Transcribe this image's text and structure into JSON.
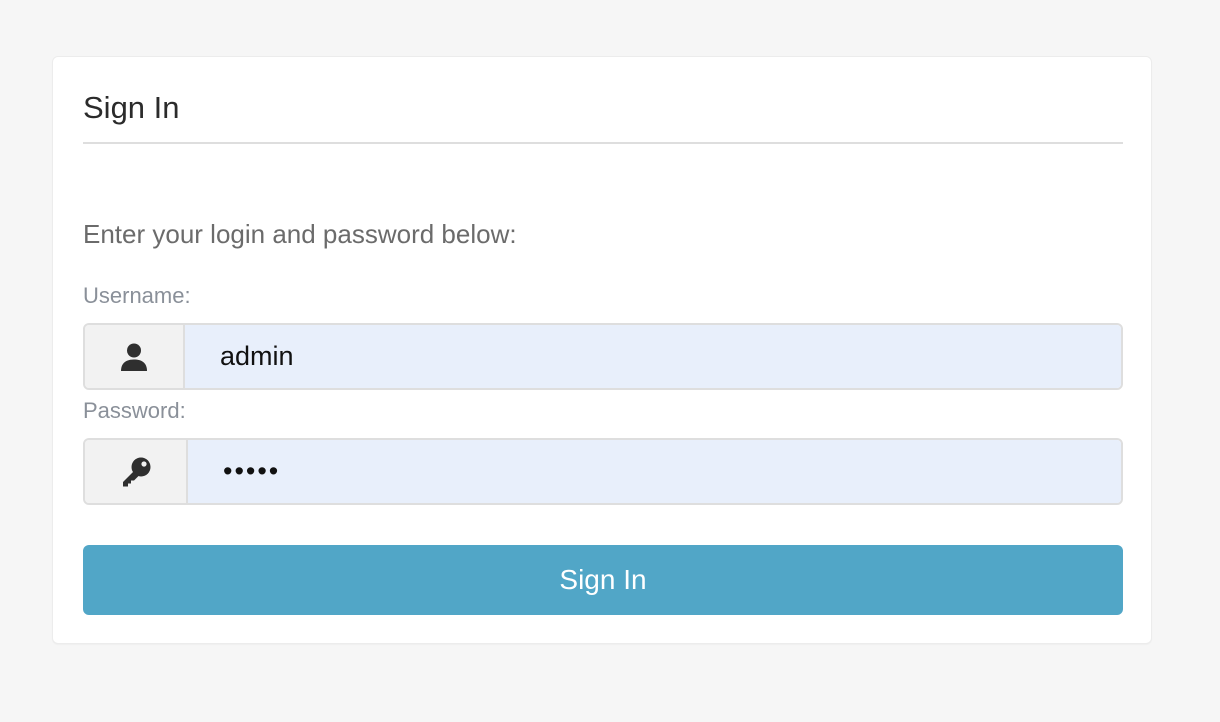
{
  "form": {
    "title": "Sign In",
    "prompt": "Enter your login and password below:",
    "username": {
      "label": "Username:",
      "value": "admin",
      "icon": "user-icon"
    },
    "password": {
      "label": "Password:",
      "value": "admin",
      "icon": "key-icon"
    },
    "submit_label": "Sign In"
  },
  "colors": {
    "page_background": "#f6f6f6",
    "card_background": "#ffffff",
    "input_fill": "#e8effb",
    "addon_fill": "#f2f2f2",
    "button": "#51a6c7",
    "button_text": "#ffffff"
  }
}
